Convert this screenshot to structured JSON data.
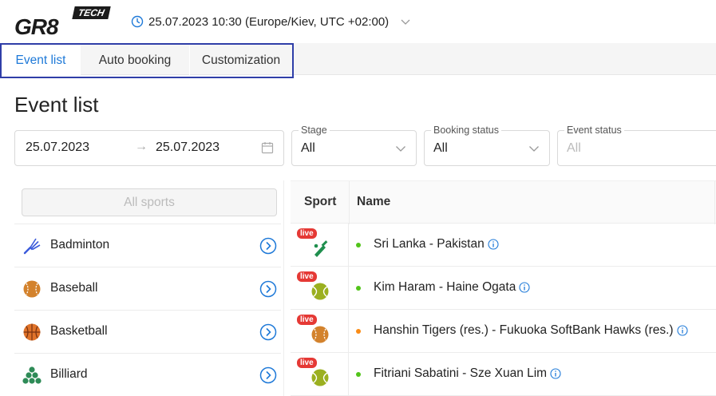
{
  "brand": {
    "logo_main": "GR8",
    "logo_tag": "TECH"
  },
  "header": {
    "datetime": "25.07.2023 10:30 (Europe/Kiev, UTC +02:00)",
    "clock_icon": "clock-icon",
    "dropdown_icon": "chevron-down-icon"
  },
  "tabs": [
    {
      "label": "Event list",
      "active": true
    },
    {
      "label": "Auto booking",
      "active": false
    },
    {
      "label": "Customization",
      "active": false
    }
  ],
  "page": {
    "title": "Event list"
  },
  "filters": {
    "date_from": "25.07.2023",
    "date_arrow": "→",
    "date_to": "25.07.2023",
    "stage": {
      "label": "Stage",
      "value": "All"
    },
    "booking_status": {
      "label": "Booking status",
      "value": "All"
    },
    "event_status": {
      "label": "Event status",
      "placeholder": "All"
    }
  },
  "sports_panel": {
    "all_label": "All sports",
    "items": [
      {
        "label": "Badminton",
        "icon": "badminton-icon"
      },
      {
        "label": "Baseball",
        "icon": "baseball-icon"
      },
      {
        "label": "Basketball",
        "icon": "basketball-icon"
      },
      {
        "label": "Billiard",
        "icon": "billiard-icon"
      }
    ]
  },
  "table": {
    "columns": [
      "Sport",
      "Name"
    ],
    "live_label": "live",
    "rows": [
      {
        "sport_icon": "cricket-icon",
        "status_color": "#52c41a",
        "name": "Sri Lanka - Pakistan"
      },
      {
        "sport_icon": "tennis-icon",
        "status_color": "#52c41a",
        "name": "Kim Haram - Haine Ogata"
      },
      {
        "sport_icon": "baseball-icon",
        "status_color": "#fa8c16",
        "name": "Hanshin Tigers (res.) - Fukuoka SoftBank Hawks (res.)"
      },
      {
        "sport_icon": "tennis-icon",
        "status_color": "#52c41a",
        "name": "Fitriani Sabatini - Sze Xuan Lim"
      }
    ]
  },
  "colors": {
    "accent": "#1e79d8",
    "tab_outline": "#2f3ea8",
    "live_badge": "#e53935",
    "status_live": "#52c41a",
    "status_pending": "#fa8c16"
  }
}
